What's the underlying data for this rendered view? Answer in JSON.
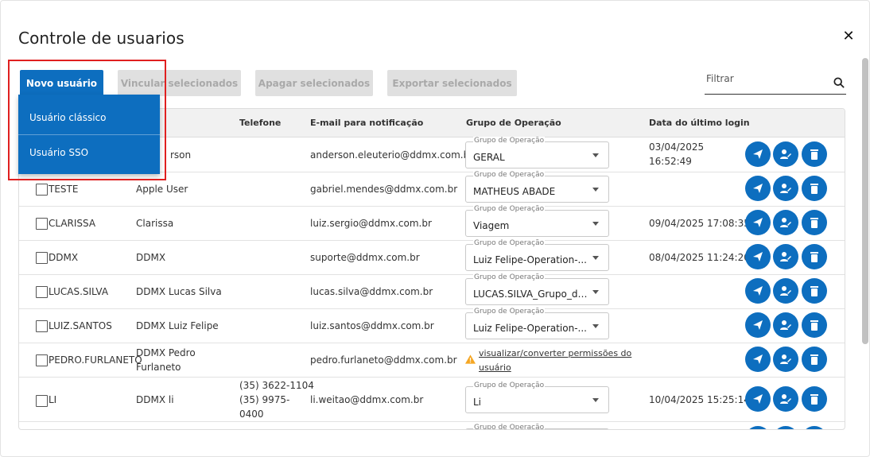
{
  "dialog": {
    "title": "Controle de usuarios",
    "close": "✕"
  },
  "toolbar": {
    "new_user": "Novo usuário",
    "link_selected": "Vincular selecionados",
    "delete_selected": "Apagar selecionados",
    "export_selected": "Exportar selecionados",
    "filter_label": "Filtrar"
  },
  "dropdown": {
    "items": [
      "Usuário clássico",
      "Usuário SSO"
    ]
  },
  "table": {
    "headers": {
      "telefone": "Telefone",
      "email": "E-mail para notificação",
      "grupo": "Grupo de Operação",
      "login": "Data do último login"
    },
    "select_label": "Grupo de Operação",
    "rows": [
      {
        "login": "",
        "name": "rson",
        "phone": "",
        "email": "anderson.eleuterio@ddmx.com.br",
        "group": "GERAL",
        "last_login": "03/04/2025",
        "last_login_time": "16:52:49"
      },
      {
        "login": "TESTE",
        "name": "Apple User",
        "phone": "",
        "email": "gabriel.mendes@ddmx.com.br",
        "group": "MATHEUS ABADE",
        "last_login": "",
        "last_login_time": ""
      },
      {
        "login": "CLARISSA",
        "name": "Clarissa",
        "phone": "",
        "email": "luiz.sergio@ddmx.com.br",
        "group": "Viagem",
        "last_login": "09/04/2025 17:08:35",
        "last_login_time": ""
      },
      {
        "login": "DDMX",
        "name": "DDMX",
        "phone": "",
        "email": "suporte@ddmx.com.br",
        "group": "Luiz Felipe-Operation-...",
        "last_login": "08/04/2025 11:24:20",
        "last_login_time": ""
      },
      {
        "login": "LUCAS.SILVA",
        "name": "DDMX Lucas Silva",
        "phone": "",
        "email": "lucas.silva@ddmx.com.br",
        "group": "LUCAS.SILVA_Grupo_de_...",
        "last_login": "",
        "last_login_time": ""
      },
      {
        "login": "LUIZ.SANTOS",
        "name": "DDMX Luiz Felipe",
        "phone": "",
        "email": "luiz.santos@ddmx.com.br",
        "group": "Luiz Felipe-Operation-...",
        "last_login": "",
        "last_login_time": ""
      },
      {
        "login": "PEDRO.FURLANETO",
        "name": "DDMX Pedro",
        "name2": "Furlaneto",
        "phone": "",
        "email": "pedro.furlaneto@ddmx.com.br",
        "warn_link": "visualizar/converter permissões do",
        "warn_link2": "usuário",
        "last_login": "",
        "last_login_time": ""
      },
      {
        "login": "LI",
        "name": "DDMX li",
        "phone": "(35) 3622-1104",
        "phone2": "(35) 9975-",
        "phone3": "0400",
        "email": "li.weitao@ddmx.com.br",
        "group": "Li",
        "last_login": "10/04/2025 15:25:14",
        "last_login_time": ""
      }
    ]
  },
  "colors": {
    "primary": "#0d6ebf",
    "highlight": "#e02020",
    "warning": "#f5a623"
  }
}
